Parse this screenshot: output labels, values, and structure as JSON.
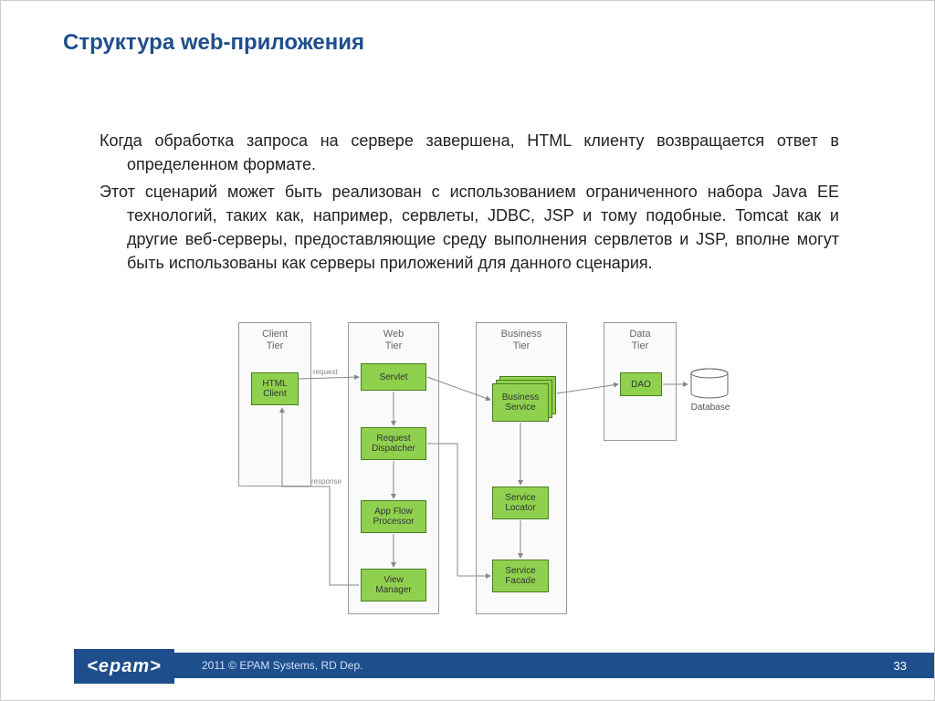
{
  "title": "Структура web-приложения",
  "paragraphs": [
    "Когда обработка запроса на сервере завершена, HTML клиенту возвращается ответ в определенном формате.",
    "Этот сценарий может быть реализован с использованием ограниченного набора Java EE технологий, таких как, например, сервлеты, JDBC, JSP и тому подобные. Tomcat как и другие веб-серверы, предоставляющие среду выполнения сервлетов и JSP, вполне могут быть использованы как серверы приложений для данного сценария."
  ],
  "diagram": {
    "tiers": {
      "client": "Client\nTier",
      "web": "Web\nTier",
      "business": "Business\nTier",
      "data": "Data\nTier"
    },
    "boxes": {
      "html_client": "HTML\nClient",
      "servlet": "Servlet",
      "request_dispatcher": "Request\nDispatcher",
      "app_flow": "App Flow\nProcessor",
      "view_manager": "View\nManager",
      "business_service": "Business\nService",
      "service_locator": "Service\nLocator",
      "service_facade": "Service\nFacade",
      "dao": "DAO"
    },
    "labels": {
      "request": "request",
      "response": "response",
      "database": "Database"
    }
  },
  "footer": {
    "logo": "<epam>",
    "copyright": "2011 © EPAM Systems, RD Dep.",
    "page": "33"
  }
}
